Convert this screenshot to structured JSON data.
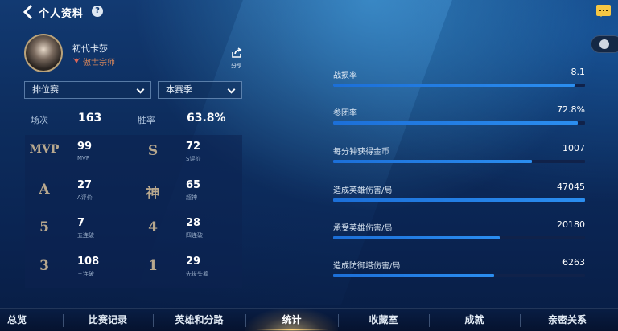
{
  "header": {
    "title": "个人资料",
    "help": "?"
  },
  "profile": {
    "name": "初代卡莎",
    "rank": "傲世宗师",
    "share_label": "分享"
  },
  "filters": {
    "mode": "排位赛",
    "season": "本赛季"
  },
  "summary": {
    "matches_label": "场次",
    "matches_value": "163",
    "winrate_label": "胜率",
    "winrate_value": "63.8%"
  },
  "grid": [
    {
      "badge": "MVP",
      "value": "99",
      "sub": "MVP"
    },
    {
      "badge": "S",
      "value": "72",
      "sub": "S评价"
    },
    {
      "badge": "A",
      "value": "27",
      "sub": "A评价"
    },
    {
      "badge": "神",
      "value": "65",
      "sub": "超神"
    },
    {
      "badge": "5",
      "value": "7",
      "sub": "五连破"
    },
    {
      "badge": "4",
      "value": "28",
      "sub": "四连破"
    },
    {
      "badge": "3",
      "value": "108",
      "sub": "三连破"
    },
    {
      "badge": "1",
      "value": "29",
      "sub": "先拔头筹"
    }
  ],
  "stats": [
    {
      "label": "战损率",
      "value": "8.1",
      "fill": 0.96
    },
    {
      "label": "参团率",
      "value": "72.8%",
      "fill": 0.97
    },
    {
      "label": "每分钟获得金币",
      "value": "1007",
      "fill": 0.79
    },
    {
      "label": "造成英雄伤害/局",
      "value": "47045",
      "fill": 1.0
    },
    {
      "label": "承受英雄伤害/局",
      "value": "20180",
      "fill": 0.66
    },
    {
      "label": "造成防御塔伤害/局",
      "value": "6263",
      "fill": 0.64
    }
  ],
  "tabs": [
    {
      "label": "总览"
    },
    {
      "label": "比赛记录"
    },
    {
      "label": "英雄和分路"
    },
    {
      "label": "统计"
    },
    {
      "label": "收藏室"
    },
    {
      "label": "成就"
    },
    {
      "label": "亲密关系"
    }
  ],
  "active_tab": "统计",
  "colors": {
    "bar": "#1c6fd8",
    "track": "#10224a",
    "rank": "#d9875a",
    "accent": "#ffd27a"
  }
}
